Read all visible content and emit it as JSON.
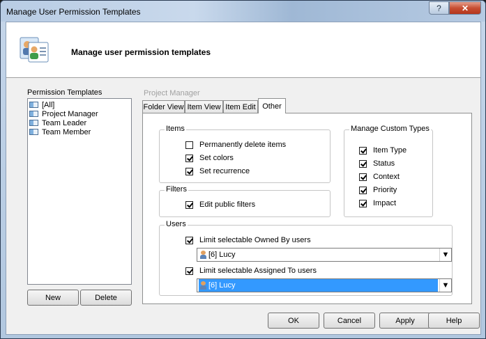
{
  "window": {
    "title": "Manage User Permission Templates",
    "help_glyph": "?",
    "close_glyph": "✕"
  },
  "header": {
    "title": "Manage user permission templates",
    "icon": "users-card-icon"
  },
  "templates": {
    "label": "Permission Templates",
    "items": [
      "[All]",
      "Project Manager",
      "Team Leader",
      "Team Member"
    ],
    "new_label": "New",
    "delete_label": "Delete"
  },
  "selected_template": "Project Manager",
  "tabs": [
    "Folder View",
    "Item View",
    "Item Edit",
    "Other"
  ],
  "active_tab": "Other",
  "items_group": {
    "title": "Items",
    "options": [
      {
        "label": "Permanently delete items",
        "checked": false
      },
      {
        "label": "Set colors",
        "checked": true
      },
      {
        "label": "Set recurrence",
        "checked": true
      }
    ]
  },
  "filters_group": {
    "title": "Filters",
    "options": [
      {
        "label": "Edit public filters",
        "checked": true
      }
    ]
  },
  "custom_types_group": {
    "title": "Manage Custom Types",
    "options": [
      {
        "label": "Item Type",
        "checked": true
      },
      {
        "label": "Status",
        "checked": true
      },
      {
        "label": "Context",
        "checked": true
      },
      {
        "label": "Priority",
        "checked": true
      },
      {
        "label": "Impact",
        "checked": true
      }
    ]
  },
  "users_group": {
    "title": "Users",
    "owned_by": {
      "label": "Limit selectable Owned By users",
      "checked": true,
      "value": "[6] Lucy"
    },
    "assigned_to": {
      "label": "Limit selectable Assigned To users",
      "checked": true,
      "value": "[6] Lucy"
    }
  },
  "footer": {
    "ok": "OK",
    "cancel": "Cancel",
    "apply": "Apply",
    "help": "Help"
  },
  "dropdown_glyph": "▼",
  "colors": {
    "selection": "#3399ff",
    "disabled_text": "#a0a0a0"
  }
}
